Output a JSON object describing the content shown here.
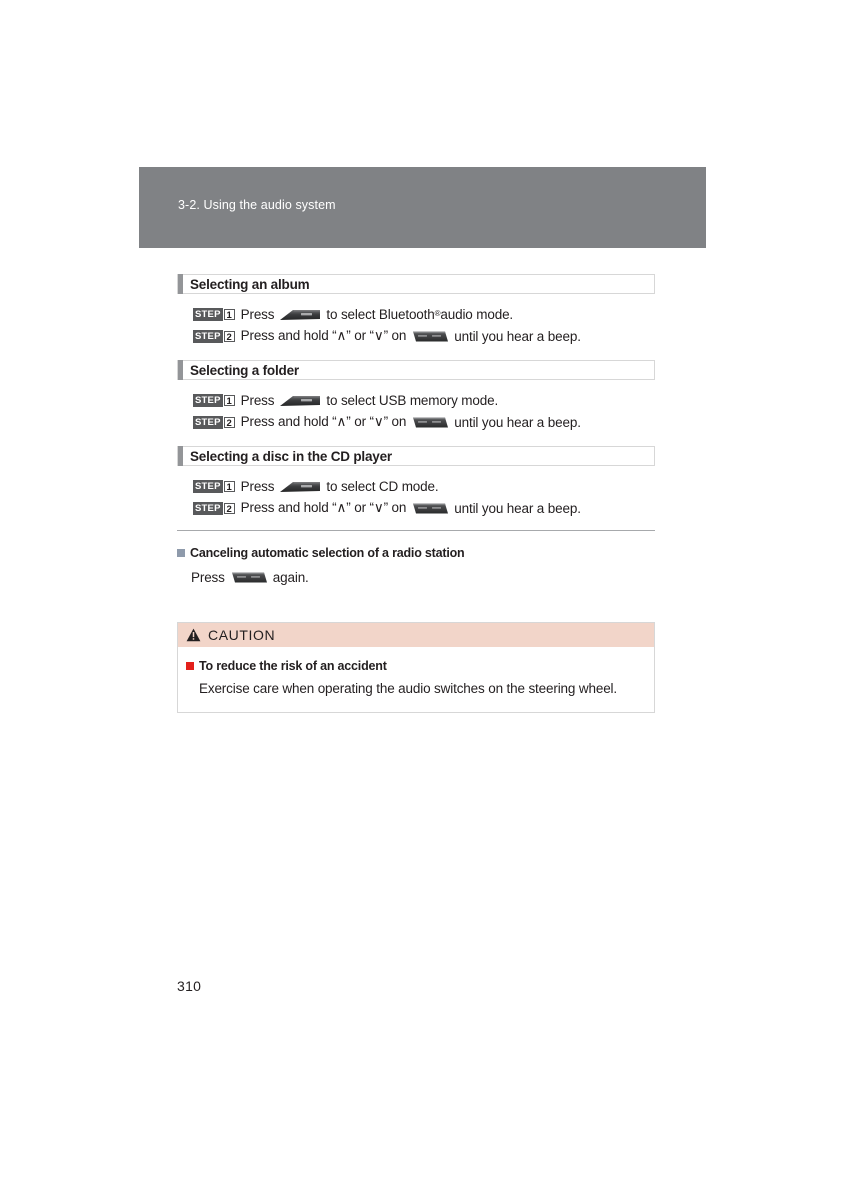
{
  "page": {
    "number": "310",
    "chapter_banner": "3-2. Using the audio system"
  },
  "sections": [
    {
      "id": "album",
      "title": "Selecting an album",
      "steps": [
        {
          "badge_word": "STEP",
          "badge_num": "1",
          "text_before": "Press",
          "icon": "audio-mode-switch-icon",
          "text_after": "to select Bluetooth",
          "superscript": "®",
          "text_tail": " audio mode."
        },
        {
          "badge_word": "STEP",
          "badge_num": "2",
          "text_before": "Press and hold “∧” or “∨” on",
          "icon": "seek-track-switch-icon",
          "text_after": "until you hear a beep.",
          "superscript": "",
          "text_tail": ""
        }
      ]
    },
    {
      "id": "folder",
      "title": "Selecting a folder",
      "steps": [
        {
          "badge_word": "STEP",
          "badge_num": "1",
          "text_before": "Press",
          "icon": "audio-mode-switch-icon",
          "text_after": "to select USB memory mode.",
          "superscript": "",
          "text_tail": ""
        },
        {
          "badge_word": "STEP",
          "badge_num": "2",
          "text_before": "Press and hold “∧” or “∨” on",
          "icon": "seek-track-switch-icon",
          "text_after": "until you hear a beep.",
          "superscript": "",
          "text_tail": ""
        }
      ]
    },
    {
      "id": "disc",
      "title": "Selecting a disc in the CD player",
      "steps": [
        {
          "badge_word": "STEP",
          "badge_num": "1",
          "text_before": "Press",
          "icon": "audio-mode-switch-icon",
          "text_after": "to select CD mode.",
          "superscript": "",
          "text_tail": ""
        },
        {
          "badge_word": "STEP",
          "badge_num": "2",
          "text_before": "Press and hold “∧” or “∨” on",
          "icon": "seek-track-switch-icon",
          "text_after": "until you hear a beep.",
          "superscript": "",
          "text_tail": ""
        }
      ]
    }
  ],
  "subsection": {
    "bullet_icon": "square-bullet-icon",
    "title": "Canceling automatic selection of a radio station",
    "text_before": "Press",
    "icon": "seek-track-switch-icon",
    "text_after": "again."
  },
  "caution": {
    "icon": "warning-triangle-icon",
    "label": "CAUTION",
    "item_bullet_icon": "red-square-bullet-icon",
    "item_title": "To reduce the risk of an accident",
    "item_text": "Exercise care when operating the audio switches on the steering wheel."
  },
  "colors": {
    "banner_gray": "#808285",
    "accent_bar": "#939598",
    "badge_dark": "#58595b",
    "caution_header_pink": "#f2d5c9",
    "red_bullet": "#e3201b",
    "blue_gray_bullet": "#8e9aab",
    "divider": "#a7a9ac",
    "border": "#d7d7d7"
  }
}
